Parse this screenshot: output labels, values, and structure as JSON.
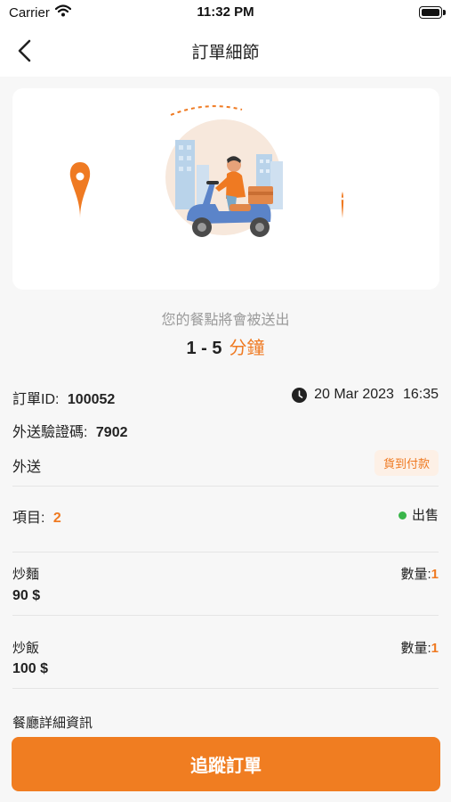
{
  "status_bar": {
    "carrier": "Carrier",
    "time": "11:32 PM"
  },
  "nav": {
    "title": "訂單細節"
  },
  "eta": {
    "label": "您的餐點將會被送出",
    "range": "1 - 5",
    "unit": "分鐘"
  },
  "order": {
    "id_label": "訂單ID:",
    "id_value": "100052",
    "date": "20 Mar 2023",
    "time": "16:35",
    "code_label": "外送驗證碼:",
    "code_value": "7902",
    "type": "外送",
    "payment_badge": "貨到付款",
    "items_label": "項目:",
    "items_count": "2",
    "status": "出售"
  },
  "items": [
    {
      "name": "炒麵",
      "price": "90 $",
      "qty_label": "數量:",
      "qty": "1"
    },
    {
      "name": "炒飯",
      "price": "100 $",
      "qty_label": "數量:",
      "qty": "1"
    }
  ],
  "restaurant_section_label": "餐廳詳細資訊",
  "cta": {
    "label": "追蹤訂單"
  },
  "colors": {
    "accent": "#f07d21",
    "status_green": "#39b54a",
    "badge_bg": "#fdf0e6"
  },
  "icons": [
    "wifi-icon",
    "battery-icon",
    "back-arrow-icon",
    "location-pin-icon",
    "delivery-scooter-illustration",
    "clock-icon"
  ]
}
